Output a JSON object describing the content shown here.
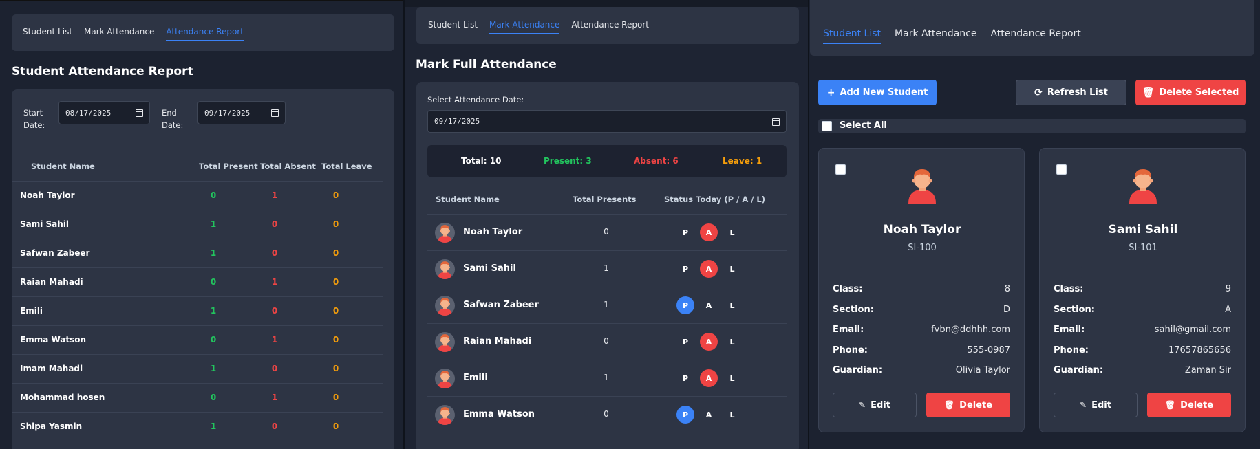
{
  "colors": {
    "accent": "#3b82f6",
    "present": "#22c55e",
    "absent": "#ef4444",
    "leave": "#f59e0b",
    "danger": "#ef4444",
    "background": "#1c2230",
    "card": "#2d3444"
  },
  "tabs": {
    "student_list": "Student List",
    "mark_attendance": "Mark Attendance",
    "attendance_report": "Attendance Report"
  },
  "report": {
    "title": "Student Attendance Report",
    "start_label": "Start Date:",
    "start_value": "08/17/2025",
    "end_label": "End Date:",
    "end_value": "09/17/2025",
    "headers": [
      "Student Name",
      "Total Present",
      "Total Absent",
      "Total Leave"
    ],
    "rows": [
      {
        "name": "Noah Taylor",
        "present": "0",
        "absent": "1",
        "leave": "0"
      },
      {
        "name": "Sami Sahil",
        "present": "1",
        "absent": "0",
        "leave": "0"
      },
      {
        "name": "Safwan Zabeer",
        "present": "1",
        "absent": "0",
        "leave": "0"
      },
      {
        "name": "Raian Mahadi",
        "present": "0",
        "absent": "1",
        "leave": "0"
      },
      {
        "name": "Emili",
        "present": "1",
        "absent": "0",
        "leave": "0"
      },
      {
        "name": "Emma Watson",
        "present": "0",
        "absent": "1",
        "leave": "0"
      },
      {
        "name": "Imam Mahadi",
        "present": "1",
        "absent": "0",
        "leave": "0"
      },
      {
        "name": "Mohammad hosen",
        "present": "0",
        "absent": "1",
        "leave": "0"
      },
      {
        "name": "Shipa Yasmin",
        "present": "1",
        "absent": "0",
        "leave": "0"
      }
    ]
  },
  "mark": {
    "title": "Mark Full Attendance",
    "date_label": "Select Attendance Date:",
    "date_value": "09/17/2025",
    "summary": {
      "total": "Total: 10",
      "present": "Present: 3",
      "absent": "Absent: 6",
      "leave": "Leave: 1"
    },
    "headers": [
      "Student Name",
      "Total Presents",
      "Status Today (P / A / L)"
    ],
    "status_letters": {
      "p": "P",
      "a": "A",
      "l": "L"
    },
    "rows": [
      {
        "name": "Noah Taylor",
        "total": "0",
        "status": "A"
      },
      {
        "name": "Sami Sahil",
        "total": "1",
        "status": "A"
      },
      {
        "name": "Safwan Zabeer",
        "total": "1",
        "status": "P"
      },
      {
        "name": "Raian Mahadi",
        "total": "0",
        "status": "A"
      },
      {
        "name": "Emili",
        "total": "1",
        "status": "A"
      },
      {
        "name": "Emma Watson",
        "total": "0",
        "status": "P"
      }
    ]
  },
  "students": {
    "add_label": "Add New Student",
    "refresh_label": "Refresh List",
    "delete_selected_label": "Delete Selected",
    "select_all_label": "Select All",
    "field_labels": {
      "class": "Class:",
      "section": "Section:",
      "email": "Email:",
      "phone": "Phone:",
      "guardian": "Guardian:"
    },
    "edit_label": "Edit",
    "delete_label": "Delete",
    "cards": [
      {
        "name": "Noah Taylor",
        "id": "SI-100",
        "class": "8",
        "section": "D",
        "email": "fvbn@ddhhh.com",
        "phone": "555-0987",
        "guardian": "Olivia Taylor"
      },
      {
        "name": "Sami Sahil",
        "id": "SI-101",
        "class": "9",
        "section": "A",
        "email": "sahil@gmail.com",
        "phone": "17657865656",
        "guardian": "Zaman Sir"
      }
    ]
  }
}
